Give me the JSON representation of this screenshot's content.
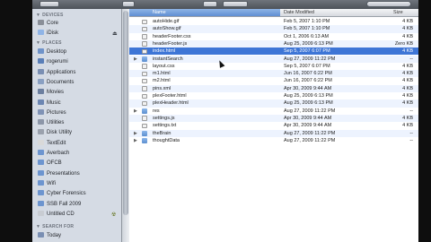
{
  "sidebar": {
    "devices_header": "DEVICES",
    "devices": [
      {
        "label": "Core",
        "icon": "hard-drive-icon",
        "color": "#8a8f98"
      },
      {
        "label": "iDisk",
        "icon": "idisk-icon",
        "color": "#8fb4e6"
      }
    ],
    "places_header": "PLACES",
    "places": [
      {
        "label": "Desktop",
        "icon": "desktop-icon",
        "color": "#6f93c9"
      },
      {
        "label": "rogerumi",
        "icon": "home-icon",
        "color": "#5a7fb8"
      },
      {
        "label": "Applications",
        "icon": "applications-icon",
        "color": "#7a8fb3"
      },
      {
        "label": "Documents",
        "icon": "documents-icon",
        "color": "#8aa0c2"
      },
      {
        "label": "Movies",
        "icon": "movies-icon",
        "color": "#6c7f9f"
      },
      {
        "label": "Music",
        "icon": "music-icon",
        "color": "#6c86b2"
      },
      {
        "label": "Pictures",
        "icon": "pictures-icon",
        "color": "#7f92b5"
      },
      {
        "label": "Utilities",
        "icon": "utilities-icon",
        "color": "#8c96a8"
      },
      {
        "label": "Disk Utility",
        "icon": "disk-utility-icon",
        "color": "#9aa1ad"
      },
      {
        "label": "TextEdit",
        "icon": "textedit-icon",
        "color": "#d9d9d9"
      },
      {
        "label": "Averbach",
        "icon": "folder-icon",
        "color": "#6d95cf"
      },
      {
        "label": "OFCB",
        "icon": "folder-icon",
        "color": "#6d95cf"
      },
      {
        "label": "Presentations",
        "icon": "folder-icon",
        "color": "#6d95cf"
      },
      {
        "label": "Wifi",
        "icon": "folder-icon",
        "color": "#6d95cf"
      },
      {
        "label": "Cyber Forensics",
        "icon": "folder-icon",
        "color": "#6d95cf"
      },
      {
        "label": "SSB Fall 2009",
        "icon": "folder-icon",
        "color": "#6d95cf"
      },
      {
        "label": "Untitled CD",
        "icon": "cd-icon",
        "color": "#c8ccd2"
      }
    ],
    "search_header": "SEARCH FOR",
    "search": [
      {
        "label": "Today",
        "icon": "clock-icon",
        "color": "#7a8fb3"
      }
    ]
  },
  "columns": {
    "name": "Name",
    "date": "Date Modified",
    "size": "Size"
  },
  "files": [
    {
      "name": "autoHide.gif",
      "date": "Feb 5, 2007 1:10 PM",
      "size": "4 KB",
      "kind": "file",
      "selected": false
    },
    {
      "name": "autoShow.gif",
      "date": "Feb 5, 2007 1:10 PM",
      "size": "4 KB",
      "kind": "file",
      "selected": false
    },
    {
      "name": "headerFooter.css",
      "date": "Oct 1, 2006 6:13 AM",
      "size": "4 KB",
      "kind": "file",
      "selected": false
    },
    {
      "name": "headerFooter.js",
      "date": "Aug 25, 2009 6:13 PM",
      "size": "Zero KB",
      "kind": "file",
      "selected": false
    },
    {
      "name": "index.html",
      "date": "Sep 5, 2007 6:07 PM",
      "size": "4 KB",
      "kind": "file",
      "selected": true
    },
    {
      "name": "instantSearch",
      "date": "Aug 27, 2009 11:22 PM",
      "size": "--",
      "kind": "folder",
      "selected": false
    },
    {
      "name": "layout.css",
      "date": "Sep 5, 2007 6:07 PM",
      "size": "4 KB",
      "kind": "file",
      "selected": false
    },
    {
      "name": "m1.html",
      "date": "Jun 16, 2007 6:22 PM",
      "size": "4 KB",
      "kind": "file",
      "selected": false
    },
    {
      "name": "m2.html",
      "date": "Jun 16, 2007 6:22 PM",
      "size": "4 KB",
      "kind": "file",
      "selected": false
    },
    {
      "name": "pins.xml",
      "date": "Apr 30, 2009 9:44 AM",
      "size": "4 KB",
      "kind": "file",
      "selected": false
    },
    {
      "name": "plexFooter.html",
      "date": "Aug 25, 2009 6:13 PM",
      "size": "4 KB",
      "kind": "file",
      "selected": false
    },
    {
      "name": "plexHeader.html",
      "date": "Aug 25, 2009 6:13 PM",
      "size": "4 KB",
      "kind": "file",
      "selected": false
    },
    {
      "name": "res",
      "date": "Aug 27, 2009 11:22 PM",
      "size": "--",
      "kind": "folder",
      "selected": false
    },
    {
      "name": "settings.js",
      "date": "Apr 30, 2009 9:44 AM",
      "size": "4 KB",
      "kind": "file",
      "selected": false
    },
    {
      "name": "settings.txt",
      "date": "Apr 30, 2009 9:44 AM",
      "size": "4 KB",
      "kind": "file",
      "selected": false
    },
    {
      "name": "theBrain",
      "date": "Aug 27, 2009 11:22 PM",
      "size": "--",
      "kind": "folder",
      "selected": false
    },
    {
      "name": "thoughtData",
      "date": "Aug 27, 2009 11:22 PM",
      "size": "--",
      "kind": "folder",
      "selected": false
    }
  ]
}
